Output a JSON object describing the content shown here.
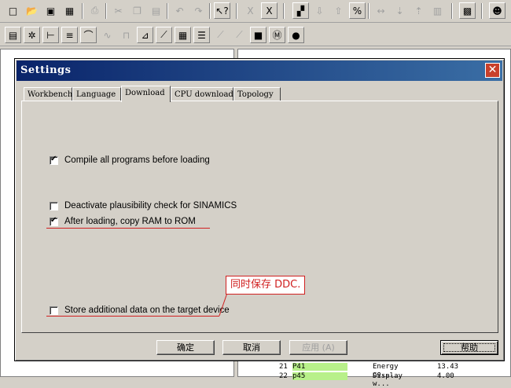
{
  "dialog": {
    "title": "Settings",
    "close_symbol": "✕",
    "tabs": [
      {
        "label": "Workbench"
      },
      {
        "label": "Language"
      },
      {
        "label": "Download"
      },
      {
        "label": "CPU download"
      },
      {
        "label": "Topology"
      }
    ],
    "options": [
      {
        "label": "Compile all programs before loading",
        "checked": true
      },
      {
        "label": "Deactivate plausibility check for SINAMICS",
        "checked": false
      },
      {
        "label": "After loading, copy RAM to ROM",
        "checked": true
      },
      {
        "label": "Store additional data on the target device",
        "checked": false
      }
    ],
    "annotation": "同时保存 DDC.",
    "buttons": {
      "ok": "确定",
      "cancel": "取消",
      "apply": "应用 (A)",
      "help": "帮助"
    }
  },
  "background_grid": {
    "rows": [
      {
        "num": "21",
        "name": "P41",
        "desc": "Energy co...",
        "value": "13.43"
      },
      {
        "num": "22",
        "name": "p45",
        "desc": "Display w...",
        "value": "4.00"
      }
    ]
  },
  "colors": {
    "title_start": "#0a246a",
    "title_end": "#3a6ea5",
    "annotation": "#d02020",
    "close_button": "#c8402b",
    "grid_highlight": "#b8f08a"
  }
}
